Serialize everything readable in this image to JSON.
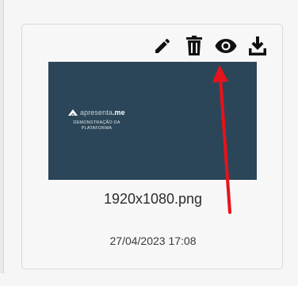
{
  "card": {
    "actions": [
      {
        "name": "edit-button",
        "icon": "pencil-icon"
      },
      {
        "name": "delete-button",
        "icon": "trash-icon"
      },
      {
        "name": "preview-button",
        "icon": "eye-icon"
      },
      {
        "name": "download-button",
        "icon": "download-icon"
      }
    ],
    "thumbnail": {
      "logo_prefix": "apresenta",
      "logo_suffix": ".me",
      "caption_line1": "DEMONSTRAÇÃO DA",
      "caption_line2": "PLATAFORMA",
      "background_color": "#2b4658"
    },
    "filename": "1920x1080.png",
    "timestamp": "27/04/2023 17:08"
  },
  "annotation": {
    "arrow_color": "#e8121b",
    "points_to": "preview-button"
  }
}
